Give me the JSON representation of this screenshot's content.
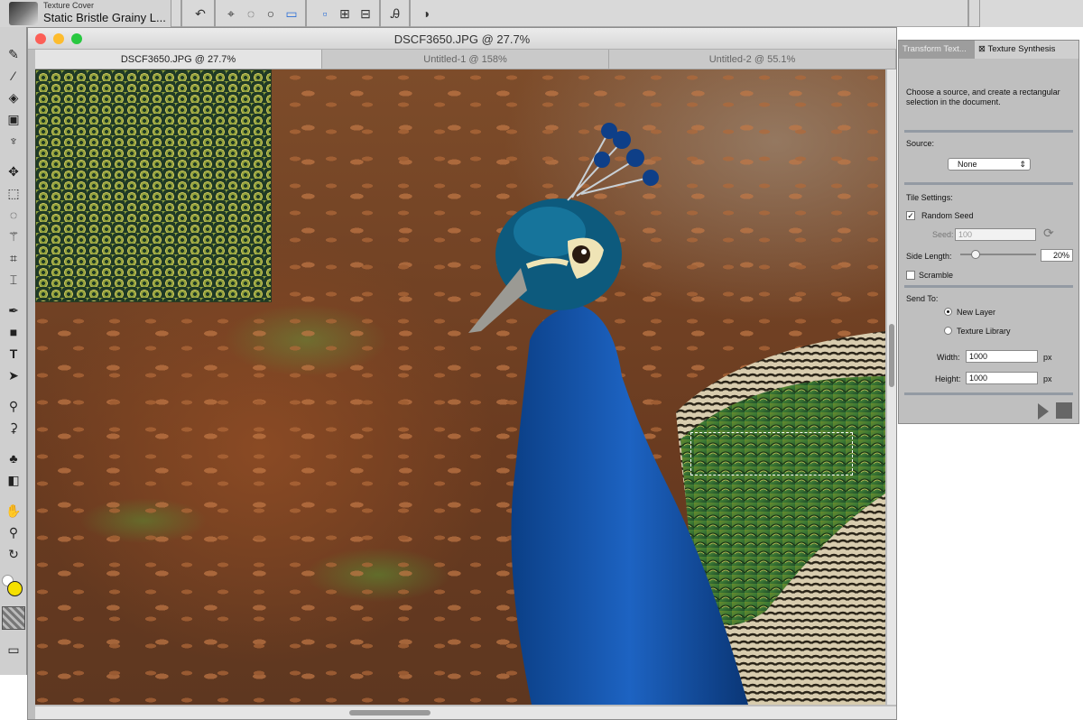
{
  "brush_preset": {
    "category": "Texture Cover",
    "name": "Static Bristle Grainy L..."
  },
  "document": {
    "title": "DSCF3650.JPG @ 27.7%",
    "tabs": [
      {
        "label": "DSCF3650.JPG @ 27.7%",
        "active": true
      },
      {
        "label": "Untitled-1 @ 158%",
        "active": false
      },
      {
        "label": "Untitled-2 @ 55.1%",
        "active": false
      }
    ]
  },
  "panel": {
    "tabs": [
      "Transform Text...",
      "Texture Synthesis"
    ],
    "instructions": "Choose a source, and create a rectangular selection in the document.",
    "source_label": "Source:",
    "source_value": "None",
    "tile_settings_label": "Tile Settings:",
    "random_seed_label": "Random Seed",
    "random_seed_checked": true,
    "seed_label": "Seed:",
    "seed_value": "100",
    "side_length_label": "Side Length:",
    "side_length_value": "20%",
    "scramble_label": "Scramble",
    "scramble_checked": false,
    "send_to_label": "Send To:",
    "send_options": [
      "New Layer",
      "Texture Library"
    ],
    "width_label": "Width:",
    "width_value": "1000",
    "width_unit": "px",
    "height_label": "Height:",
    "height_value": "1000",
    "height_unit": "px"
  },
  "colors": {
    "foreground": "#f5e000",
    "background": "#ffffff",
    "accent": "#2d6fd6"
  },
  "icons": {
    "toolbar": [
      "undo-arrow-icon",
      "lasso-icon",
      "freehand-lasso-icon",
      "ellipse-select-icon",
      "rect-select-icon",
      "new-selection-icon",
      "add-selection-icon",
      "subtract-selection-icon",
      "text-effect-icon",
      "mask-circle-icon"
    ],
    "tools": [
      "paint-brush-icon",
      "eyedropper-icon",
      "paint-bucket-icon",
      "gradient-icon",
      "smudge-icon",
      "move-icon",
      "marquee-icon",
      "lasso-tool-icon",
      "magic-wand-icon",
      "transform-icon",
      "crop-icon",
      "pen-icon",
      "shape-icon",
      "text-tool-icon",
      "path-select-icon",
      "stamp-icon",
      "dropper-icon",
      "plant-icon",
      "layer-icon",
      "hand-icon",
      "zoom-icon",
      "rotate-icon",
      "screen-mode-icon"
    ]
  }
}
